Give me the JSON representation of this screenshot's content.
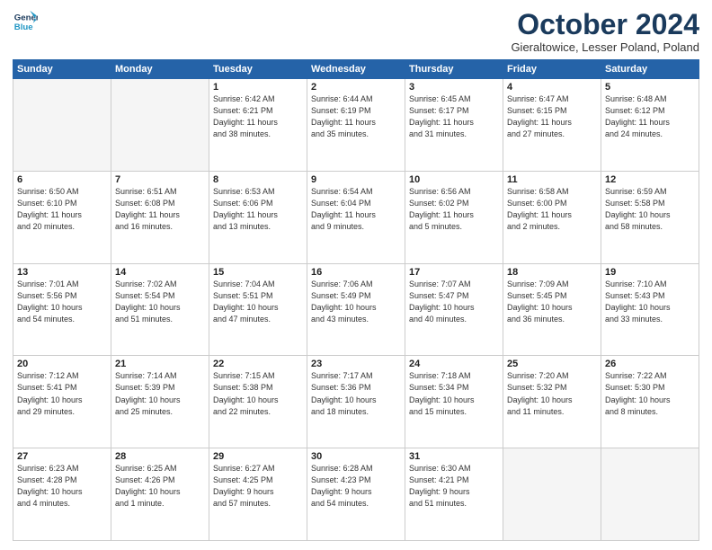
{
  "header": {
    "logo_line1": "General",
    "logo_line2": "Blue",
    "month": "October 2024",
    "location": "Gieraltowice, Lesser Poland, Poland"
  },
  "weekdays": [
    "Sunday",
    "Monday",
    "Tuesday",
    "Wednesday",
    "Thursday",
    "Friday",
    "Saturday"
  ],
  "weeks": [
    [
      {
        "day": "",
        "info": ""
      },
      {
        "day": "",
        "info": ""
      },
      {
        "day": "1",
        "info": "Sunrise: 6:42 AM\nSunset: 6:21 PM\nDaylight: 11 hours\nand 38 minutes."
      },
      {
        "day": "2",
        "info": "Sunrise: 6:44 AM\nSunset: 6:19 PM\nDaylight: 11 hours\nand 35 minutes."
      },
      {
        "day": "3",
        "info": "Sunrise: 6:45 AM\nSunset: 6:17 PM\nDaylight: 11 hours\nand 31 minutes."
      },
      {
        "day": "4",
        "info": "Sunrise: 6:47 AM\nSunset: 6:15 PM\nDaylight: 11 hours\nand 27 minutes."
      },
      {
        "day": "5",
        "info": "Sunrise: 6:48 AM\nSunset: 6:12 PM\nDaylight: 11 hours\nand 24 minutes."
      }
    ],
    [
      {
        "day": "6",
        "info": "Sunrise: 6:50 AM\nSunset: 6:10 PM\nDaylight: 11 hours\nand 20 minutes."
      },
      {
        "day": "7",
        "info": "Sunrise: 6:51 AM\nSunset: 6:08 PM\nDaylight: 11 hours\nand 16 minutes."
      },
      {
        "day": "8",
        "info": "Sunrise: 6:53 AM\nSunset: 6:06 PM\nDaylight: 11 hours\nand 13 minutes."
      },
      {
        "day": "9",
        "info": "Sunrise: 6:54 AM\nSunset: 6:04 PM\nDaylight: 11 hours\nand 9 minutes."
      },
      {
        "day": "10",
        "info": "Sunrise: 6:56 AM\nSunset: 6:02 PM\nDaylight: 11 hours\nand 5 minutes."
      },
      {
        "day": "11",
        "info": "Sunrise: 6:58 AM\nSunset: 6:00 PM\nDaylight: 11 hours\nand 2 minutes."
      },
      {
        "day": "12",
        "info": "Sunrise: 6:59 AM\nSunset: 5:58 PM\nDaylight: 10 hours\nand 58 minutes."
      }
    ],
    [
      {
        "day": "13",
        "info": "Sunrise: 7:01 AM\nSunset: 5:56 PM\nDaylight: 10 hours\nand 54 minutes."
      },
      {
        "day": "14",
        "info": "Sunrise: 7:02 AM\nSunset: 5:54 PM\nDaylight: 10 hours\nand 51 minutes."
      },
      {
        "day": "15",
        "info": "Sunrise: 7:04 AM\nSunset: 5:51 PM\nDaylight: 10 hours\nand 47 minutes."
      },
      {
        "day": "16",
        "info": "Sunrise: 7:06 AM\nSunset: 5:49 PM\nDaylight: 10 hours\nand 43 minutes."
      },
      {
        "day": "17",
        "info": "Sunrise: 7:07 AM\nSunset: 5:47 PM\nDaylight: 10 hours\nand 40 minutes."
      },
      {
        "day": "18",
        "info": "Sunrise: 7:09 AM\nSunset: 5:45 PM\nDaylight: 10 hours\nand 36 minutes."
      },
      {
        "day": "19",
        "info": "Sunrise: 7:10 AM\nSunset: 5:43 PM\nDaylight: 10 hours\nand 33 minutes."
      }
    ],
    [
      {
        "day": "20",
        "info": "Sunrise: 7:12 AM\nSunset: 5:41 PM\nDaylight: 10 hours\nand 29 minutes."
      },
      {
        "day": "21",
        "info": "Sunrise: 7:14 AM\nSunset: 5:39 PM\nDaylight: 10 hours\nand 25 minutes."
      },
      {
        "day": "22",
        "info": "Sunrise: 7:15 AM\nSunset: 5:38 PM\nDaylight: 10 hours\nand 22 minutes."
      },
      {
        "day": "23",
        "info": "Sunrise: 7:17 AM\nSunset: 5:36 PM\nDaylight: 10 hours\nand 18 minutes."
      },
      {
        "day": "24",
        "info": "Sunrise: 7:18 AM\nSunset: 5:34 PM\nDaylight: 10 hours\nand 15 minutes."
      },
      {
        "day": "25",
        "info": "Sunrise: 7:20 AM\nSunset: 5:32 PM\nDaylight: 10 hours\nand 11 minutes."
      },
      {
        "day": "26",
        "info": "Sunrise: 7:22 AM\nSunset: 5:30 PM\nDaylight: 10 hours\nand 8 minutes."
      }
    ],
    [
      {
        "day": "27",
        "info": "Sunrise: 6:23 AM\nSunset: 4:28 PM\nDaylight: 10 hours\nand 4 minutes."
      },
      {
        "day": "28",
        "info": "Sunrise: 6:25 AM\nSunset: 4:26 PM\nDaylight: 10 hours\nand 1 minute."
      },
      {
        "day": "29",
        "info": "Sunrise: 6:27 AM\nSunset: 4:25 PM\nDaylight: 9 hours\nand 57 minutes."
      },
      {
        "day": "30",
        "info": "Sunrise: 6:28 AM\nSunset: 4:23 PM\nDaylight: 9 hours\nand 54 minutes."
      },
      {
        "day": "31",
        "info": "Sunrise: 6:30 AM\nSunset: 4:21 PM\nDaylight: 9 hours\nand 51 minutes."
      },
      {
        "day": "",
        "info": ""
      },
      {
        "day": "",
        "info": ""
      }
    ]
  ]
}
